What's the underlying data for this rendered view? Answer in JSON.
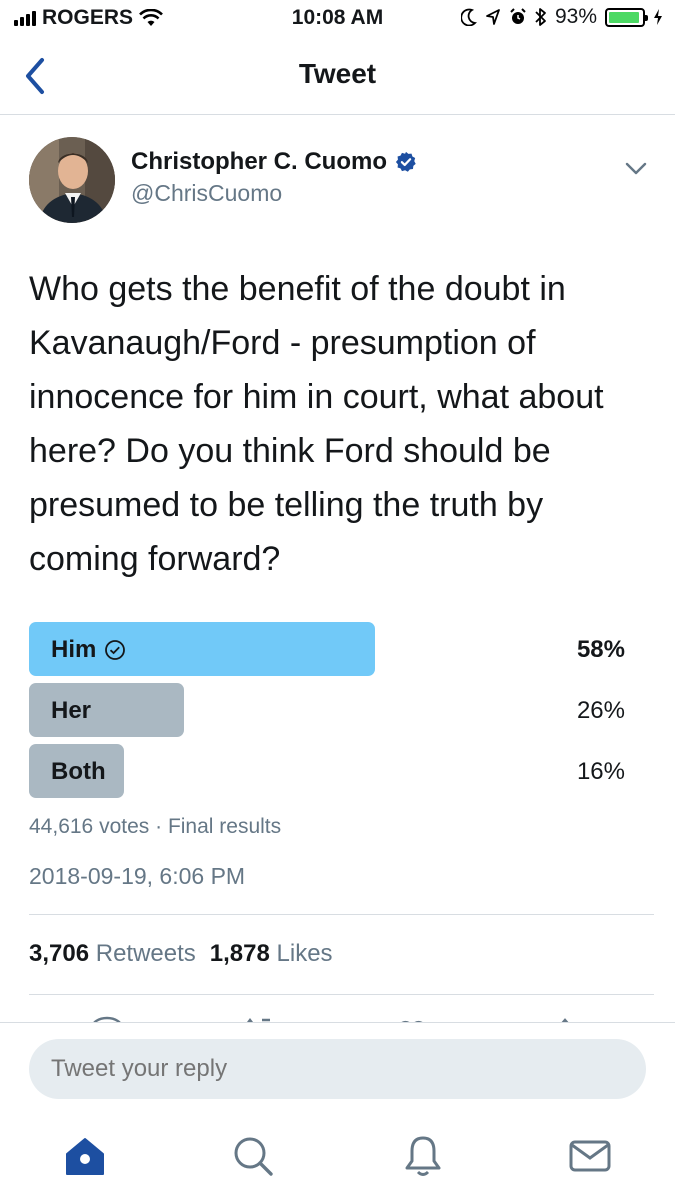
{
  "status_bar": {
    "carrier": "ROGERS",
    "time": "10:08 AM",
    "battery_percent": "93%",
    "battery_level": 0.93
  },
  "nav": {
    "title": "Tweet"
  },
  "tweet": {
    "author_name": "Christopher C. Cuomo",
    "author_handle": "@ChrisCuomo",
    "text": "Who gets the benefit of the doubt in Kavanaugh/Ford - presumption of innocence for him in court, what about here? Do you think Ford should be presumed to be telling the truth by coming forward?",
    "timestamp": "2018-09-19, 6:06 PM"
  },
  "poll": {
    "options": [
      {
        "label": "Him",
        "percent_text": "58%",
        "share": 0.58,
        "winner": true
      },
      {
        "label": "Her",
        "percent_text": "26%",
        "share": 0.26,
        "winner": false
      },
      {
        "label": "Both",
        "percent_text": "16%",
        "share": 0.16,
        "winner": false
      }
    ],
    "votes": "44,616 votes",
    "status": "Final results"
  },
  "stats": {
    "retweets_count": "3,706",
    "retweets_label": "Retweets",
    "likes_count": "1,878",
    "likes_label": "Likes"
  },
  "reply": {
    "placeholder": "Tweet your reply"
  },
  "colors": {
    "winner_bar": "#71c9f8",
    "loser_bar": "#aab8c2",
    "brand_blue": "#1d4fa1",
    "verified_blue": "#1da1f2"
  },
  "tabs": [
    "home-icon",
    "search-icon",
    "notifications-icon",
    "messages-icon"
  ]
}
